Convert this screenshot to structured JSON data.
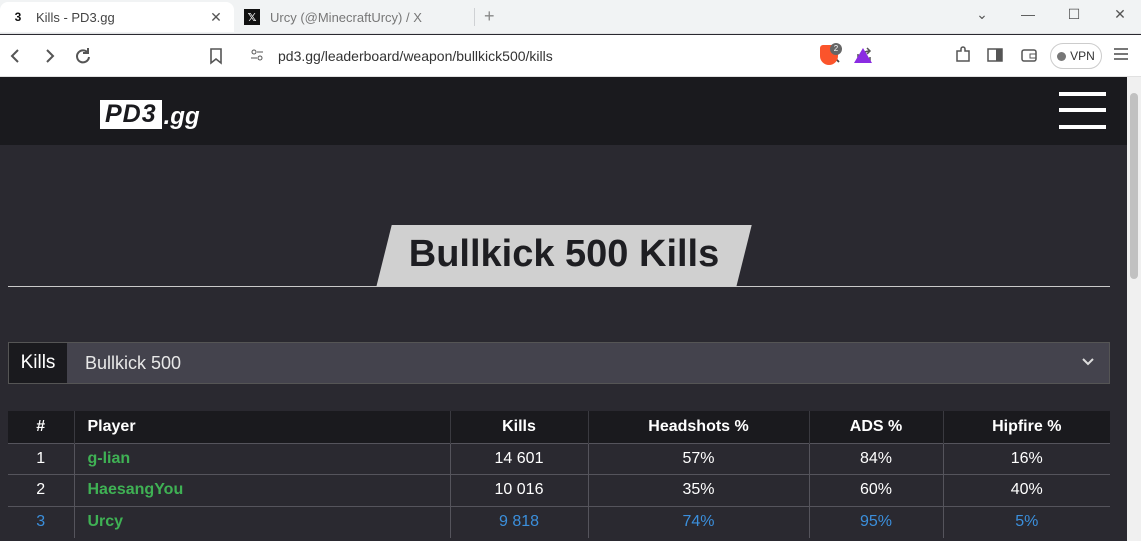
{
  "browser": {
    "tabs": [
      {
        "favicon": "3",
        "title": "Kills - PD3.gg",
        "close": "✕"
      },
      {
        "favicon": "𝕏",
        "title": "Urcy (@MinecraftUrcy) / X"
      }
    ],
    "new_tab": "+",
    "window_controls": {
      "dropdown": "⌄",
      "minimize": "—",
      "maximize": "☐",
      "close": "✕"
    },
    "url": "pd3.gg/leaderboard/weapon/bullkick500/kills",
    "shields_count": "2",
    "vpn_label": "VPN",
    "icons": [
      "back-icon",
      "forward-icon",
      "reload-icon",
      "bookmark-icon",
      "site-settings-icon",
      "zoom-icon",
      "share-icon",
      "brave-shields-icon",
      "brave-rewards-icon",
      "extensions-icon",
      "sidebar-icon",
      "wallet-icon",
      "menu-icon"
    ]
  },
  "site": {
    "logo_main": "PD3",
    "logo_tld": ".gg",
    "heading": "Bullkick 500 Kills",
    "filter": {
      "label": "Kills",
      "selected": "Bullkick 500"
    },
    "accent_colors": {
      "player": "#3fb154",
      "highlight": "#3b8fdc"
    }
  },
  "table": {
    "headers": [
      "#",
      "Player",
      "Kills",
      "Headshots %",
      "ADS %",
      "Hipfire %"
    ],
    "rows": [
      {
        "rank": "1",
        "player": "g-lian",
        "kills": "14 601",
        "headshots": "57%",
        "ads": "84%",
        "hipfire": "16%"
      },
      {
        "rank": "2",
        "player": "HaesangYou",
        "kills": "10 016",
        "headshots": "35%",
        "ads": "60%",
        "hipfire": "40%"
      },
      {
        "rank": "3",
        "player": "Urcy",
        "kills": "9 818",
        "headshots": "74%",
        "ads": "95%",
        "hipfire": "5%"
      }
    ]
  }
}
